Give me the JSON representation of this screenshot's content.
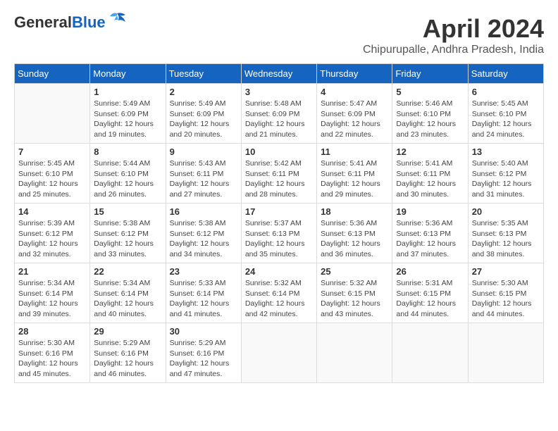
{
  "header": {
    "logo_line1": "General",
    "logo_line2": "Blue",
    "month_title": "April 2024",
    "location": "Chipurupalle, Andhra Pradesh, India"
  },
  "weekdays": [
    "Sunday",
    "Monday",
    "Tuesday",
    "Wednesday",
    "Thursday",
    "Friday",
    "Saturday"
  ],
  "weeks": [
    [
      {
        "day": "",
        "info": ""
      },
      {
        "day": "1",
        "info": "Sunrise: 5:49 AM\nSunset: 6:09 PM\nDaylight: 12 hours\nand 19 minutes."
      },
      {
        "day": "2",
        "info": "Sunrise: 5:49 AM\nSunset: 6:09 PM\nDaylight: 12 hours\nand 20 minutes."
      },
      {
        "day": "3",
        "info": "Sunrise: 5:48 AM\nSunset: 6:09 PM\nDaylight: 12 hours\nand 21 minutes."
      },
      {
        "day": "4",
        "info": "Sunrise: 5:47 AM\nSunset: 6:09 PM\nDaylight: 12 hours\nand 22 minutes."
      },
      {
        "day": "5",
        "info": "Sunrise: 5:46 AM\nSunset: 6:10 PM\nDaylight: 12 hours\nand 23 minutes."
      },
      {
        "day": "6",
        "info": "Sunrise: 5:45 AM\nSunset: 6:10 PM\nDaylight: 12 hours\nand 24 minutes."
      }
    ],
    [
      {
        "day": "7",
        "info": "Sunrise: 5:45 AM\nSunset: 6:10 PM\nDaylight: 12 hours\nand 25 minutes."
      },
      {
        "day": "8",
        "info": "Sunrise: 5:44 AM\nSunset: 6:10 PM\nDaylight: 12 hours\nand 26 minutes."
      },
      {
        "day": "9",
        "info": "Sunrise: 5:43 AM\nSunset: 6:11 PM\nDaylight: 12 hours\nand 27 minutes."
      },
      {
        "day": "10",
        "info": "Sunrise: 5:42 AM\nSunset: 6:11 PM\nDaylight: 12 hours\nand 28 minutes."
      },
      {
        "day": "11",
        "info": "Sunrise: 5:41 AM\nSunset: 6:11 PM\nDaylight: 12 hours\nand 29 minutes."
      },
      {
        "day": "12",
        "info": "Sunrise: 5:41 AM\nSunset: 6:11 PM\nDaylight: 12 hours\nand 30 minutes."
      },
      {
        "day": "13",
        "info": "Sunrise: 5:40 AM\nSunset: 6:12 PM\nDaylight: 12 hours\nand 31 minutes."
      }
    ],
    [
      {
        "day": "14",
        "info": "Sunrise: 5:39 AM\nSunset: 6:12 PM\nDaylight: 12 hours\nand 32 minutes."
      },
      {
        "day": "15",
        "info": "Sunrise: 5:38 AM\nSunset: 6:12 PM\nDaylight: 12 hours\nand 33 minutes."
      },
      {
        "day": "16",
        "info": "Sunrise: 5:38 AM\nSunset: 6:12 PM\nDaylight: 12 hours\nand 34 minutes."
      },
      {
        "day": "17",
        "info": "Sunrise: 5:37 AM\nSunset: 6:13 PM\nDaylight: 12 hours\nand 35 minutes."
      },
      {
        "day": "18",
        "info": "Sunrise: 5:36 AM\nSunset: 6:13 PM\nDaylight: 12 hours\nand 36 minutes."
      },
      {
        "day": "19",
        "info": "Sunrise: 5:36 AM\nSunset: 6:13 PM\nDaylight: 12 hours\nand 37 minutes."
      },
      {
        "day": "20",
        "info": "Sunrise: 5:35 AM\nSunset: 6:13 PM\nDaylight: 12 hours\nand 38 minutes."
      }
    ],
    [
      {
        "day": "21",
        "info": "Sunrise: 5:34 AM\nSunset: 6:14 PM\nDaylight: 12 hours\nand 39 minutes."
      },
      {
        "day": "22",
        "info": "Sunrise: 5:34 AM\nSunset: 6:14 PM\nDaylight: 12 hours\nand 40 minutes."
      },
      {
        "day": "23",
        "info": "Sunrise: 5:33 AM\nSunset: 6:14 PM\nDaylight: 12 hours\nand 41 minutes."
      },
      {
        "day": "24",
        "info": "Sunrise: 5:32 AM\nSunset: 6:14 PM\nDaylight: 12 hours\nand 42 minutes."
      },
      {
        "day": "25",
        "info": "Sunrise: 5:32 AM\nSunset: 6:15 PM\nDaylight: 12 hours\nand 43 minutes."
      },
      {
        "day": "26",
        "info": "Sunrise: 5:31 AM\nSunset: 6:15 PM\nDaylight: 12 hours\nand 44 minutes."
      },
      {
        "day": "27",
        "info": "Sunrise: 5:30 AM\nSunset: 6:15 PM\nDaylight: 12 hours\nand 44 minutes."
      }
    ],
    [
      {
        "day": "28",
        "info": "Sunrise: 5:30 AM\nSunset: 6:16 PM\nDaylight: 12 hours\nand 45 minutes."
      },
      {
        "day": "29",
        "info": "Sunrise: 5:29 AM\nSunset: 6:16 PM\nDaylight: 12 hours\nand 46 minutes."
      },
      {
        "day": "30",
        "info": "Sunrise: 5:29 AM\nSunset: 6:16 PM\nDaylight: 12 hours\nand 47 minutes."
      },
      {
        "day": "",
        "info": ""
      },
      {
        "day": "",
        "info": ""
      },
      {
        "day": "",
        "info": ""
      },
      {
        "day": "",
        "info": ""
      }
    ]
  ]
}
